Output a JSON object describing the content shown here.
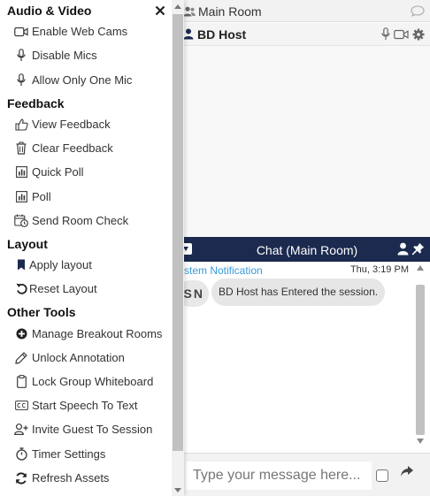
{
  "room": {
    "title": "Main Room",
    "host_name": "BD Host"
  },
  "chat": {
    "header_title": "Chat (Main Room)",
    "system_label": "ystem Notification",
    "time": "Thu, 3:19 PM",
    "avatar_initials": "SN",
    "message": "BD Host has Entered the session.",
    "input_placeholder": "Type your message here..."
  },
  "menu": {
    "audio_video": {
      "title": "Audio & Video",
      "items": [
        "Enable Web Cams",
        "Disable Mics",
        "Allow Only One Mic"
      ]
    },
    "feedback": {
      "title": "Feedback",
      "items": [
        "View Feedback",
        "Clear Feedback",
        "Quick Poll",
        "Poll",
        "Send Room Check"
      ]
    },
    "layout": {
      "title": "Layout",
      "items": [
        "Apply layout",
        "Reset Layout"
      ]
    },
    "other_tools": {
      "title": "Other Tools",
      "items": [
        "Manage Breakout Rooms",
        "Unlock Annotation",
        "Lock Group Whiteboard",
        "Start Speech To Text",
        "Invite Guest To Session",
        "Timer Settings",
        "Refresh Assets"
      ]
    }
  },
  "colors": {
    "navy": "#1b2a4e",
    "system_blue": "#3a9ad9",
    "menu_icon": "#3a3a3a"
  }
}
